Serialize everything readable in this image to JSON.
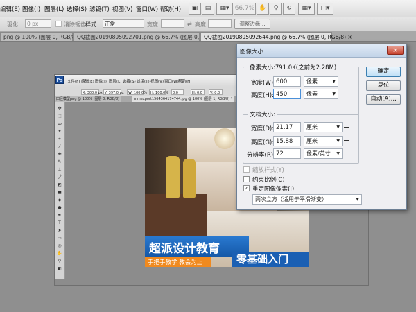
{
  "menubar": {
    "items": [
      "编辑(E)",
      "图像(I)",
      "图层(L)",
      "选择(S)",
      "滤镜(T)",
      "视图(V)",
      "窗口(W)",
      "帮助(H)"
    ],
    "zoom": "66.7%",
    "icons": [
      "bridge-icon",
      "mini-bridge-icon",
      "view-extras-icon",
      "zoom-level",
      "hand-icon",
      "zoom-icon",
      "rotate-icon",
      "arrange-icon",
      "screen-mode-icon"
    ]
  },
  "options": {
    "feather_label": "羽化:",
    "feather_value": "0 px",
    "antialias_label": "消除锯齿",
    "style_label": "样式:",
    "style_value": "正常",
    "width_label": "宽度:",
    "height_label": "高度:",
    "refine_edge": "调整边缘..."
  },
  "tabs": [
    {
      "label": "png @ 100% (图层 0, RGB/8)",
      "close": "×"
    },
    {
      "label": "QQ截图20190805092701.png @ 66.7% (图层 0, RGB/8)",
      "close": "×"
    },
    {
      "label": "QQ截图20190805092644.png @ 66.7% (图层 0, RGB/8)",
      "close": "×"
    }
  ],
  "inner": {
    "logo": "Ps",
    "menu": [
      "文件(F)",
      "编辑(E)",
      "图像(I)",
      "图层(L)",
      "选择(S)",
      "滤镜(T)",
      "视图(V)",
      "窗口(W)",
      "帮助(H)"
    ],
    "opt_fields": [
      "X: 300.0 px",
      "Y: 397.0 px",
      "W: 100.0%",
      "H: 100.0%",
      "0.0",
      "H: 0.0",
      "V: 0.0"
    ],
    "tabs": [
      "田径模型png @ 100% (图层 0, RGB/8)",
      "mmexport1564364174744.jpg @ 100% (图层 1, RGB/8) *"
    ],
    "banner_title": "超派设计教育",
    "banner_sub": "手把手教学  教会为止",
    "banner_right": "零基础入门"
  },
  "dialog": {
    "title": "图像大小",
    "close": "×",
    "pixel_dims_label": "像素大小:791.0K(之前为2.28M)",
    "width_label": "宽度(W):",
    "width_value": "600",
    "width_unit": "像素",
    "height_label": "高度(H):",
    "height_value": "450",
    "height_unit": "像素",
    "doc_size_label": "文档大小:",
    "doc_width_label": "宽度(D):",
    "doc_width_value": "21.17",
    "doc_width_unit": "厘米",
    "doc_height_label": "高度(G):",
    "doc_height_value": "15.88",
    "doc_height_unit": "厘米",
    "resolution_label": "分辨率(R):",
    "resolution_value": "72",
    "resolution_unit": "像素/英寸",
    "scale_styles": "缩放样式(Y)",
    "constrain": "约束比例(C)",
    "resample": "重定图像像素(I):",
    "resample_method": "两次立方（适用于平滑渐变）",
    "ok": "确定",
    "reset": "复位",
    "auto": "自动(A)..."
  }
}
